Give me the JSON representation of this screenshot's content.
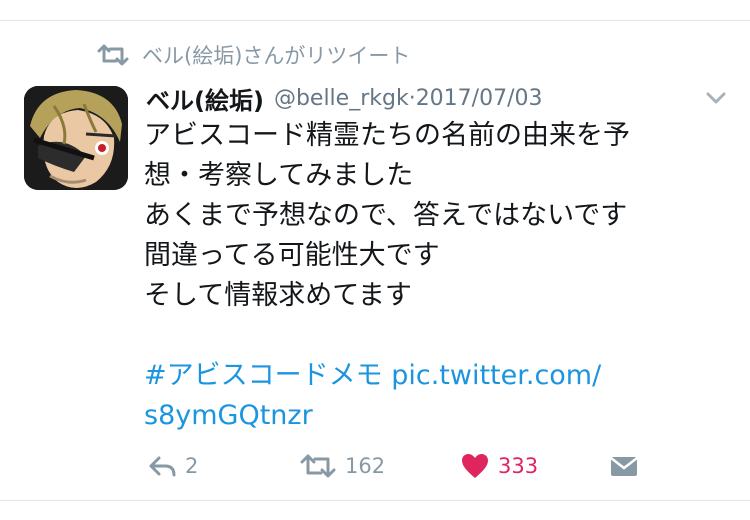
{
  "retweet_context": {
    "text": "ベル(絵垢)さんがリツイート",
    "icon": "retweet-icon"
  },
  "tweet": {
    "author_name": "ベル(絵垢)",
    "handle": "@belle_rkgk",
    "date_sep": " · ",
    "date": "2017/07/03",
    "lines": [
      "アビスコード精霊たちの名前の由来を予",
      "想・考察してみました",
      "あくまで予想なので、答えではないです",
      "間違ってる可能性大です",
      "そして情報求めてます"
    ],
    "hashtag": "#アビスコードメモ",
    "link_part1": "pic.twitter.com/",
    "link_part2": "s8ymGQtnzr"
  },
  "actions": {
    "reply_count": "2",
    "retweet_count": "162",
    "like_count": "333"
  },
  "icons": {
    "reply": "reply-icon",
    "retweet": "retweet-icon",
    "like": "heart-icon",
    "dm": "direct-message-icon",
    "menu": "chevron-down-icon"
  },
  "colors": {
    "link": "#1b95e0",
    "muted": "#8899a6",
    "like": "#e0245e",
    "text": "#14171a"
  }
}
